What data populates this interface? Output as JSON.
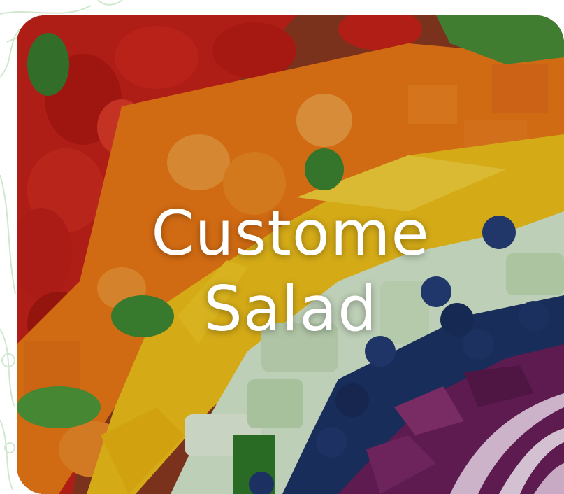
{
  "card": {
    "title_line_1": "Custome",
    "title_line_2": "Salad",
    "image_icon": "salad-photo",
    "colors": {
      "tomato": "#c8231a",
      "carrot": "#ee7a16",
      "pepper": "#f2c21b",
      "cucumber": "#d8ecd0",
      "blueberry": "#1d3468",
      "cabbage": "#6b1f5a",
      "onion": "#e9cce6",
      "lettuce": "#3f8a34",
      "pattern": "#cfe8cf"
    }
  }
}
